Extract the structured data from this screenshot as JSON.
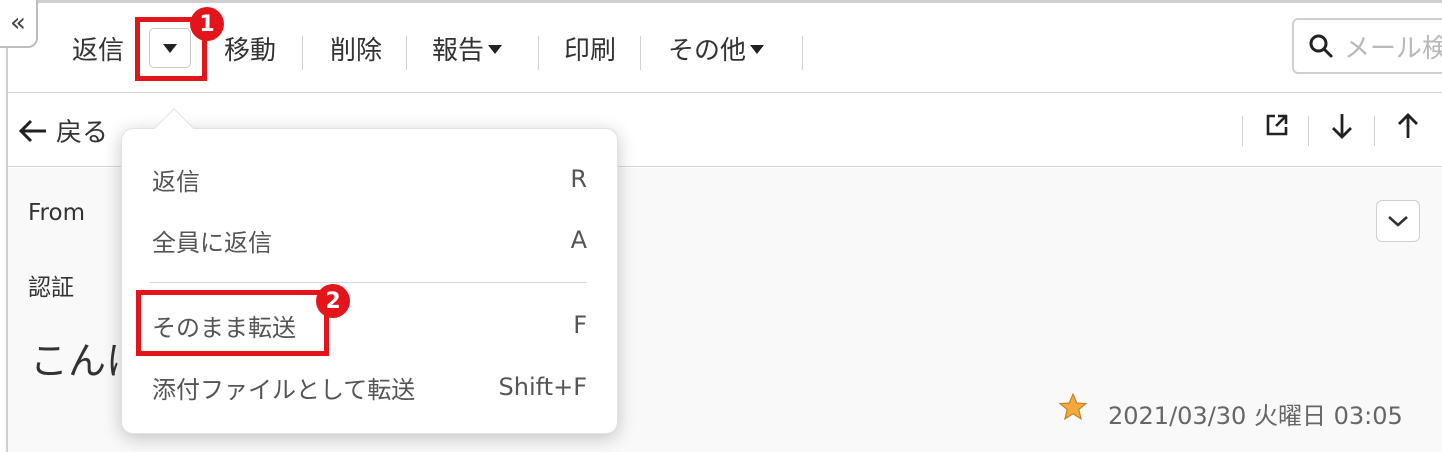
{
  "toolbar": {
    "reply": "返信",
    "move": "移動",
    "delete": "削除",
    "report": "報告",
    "print": "印刷",
    "other": "その他",
    "search_placeholder": "メール検"
  },
  "back_label": "戻る",
  "mail": {
    "from_label": "From",
    "auth_label": "認証",
    "subject_partial": "こんに",
    "date": "2021/03/30 火曜日 03:05"
  },
  "menu": {
    "items": [
      {
        "label": "返信",
        "shortcut": "R"
      },
      {
        "label": "全員に返信",
        "shortcut": "A"
      },
      {
        "label": "そのまま転送",
        "shortcut": "F"
      },
      {
        "label": "添付ファイルとして転送",
        "shortcut": "Shift+F"
      }
    ]
  },
  "callouts": {
    "one": "1",
    "two": "2"
  },
  "colors": {
    "highlight": "#e3151a",
    "star": "#f0a93a"
  },
  "icons": [
    "collapse-icon",
    "dropdown-arrow-icon",
    "search-icon",
    "back-arrow-icon",
    "open-external-icon",
    "arrow-down-icon",
    "arrow-up-icon",
    "chevron-down-icon",
    "star-icon"
  ]
}
